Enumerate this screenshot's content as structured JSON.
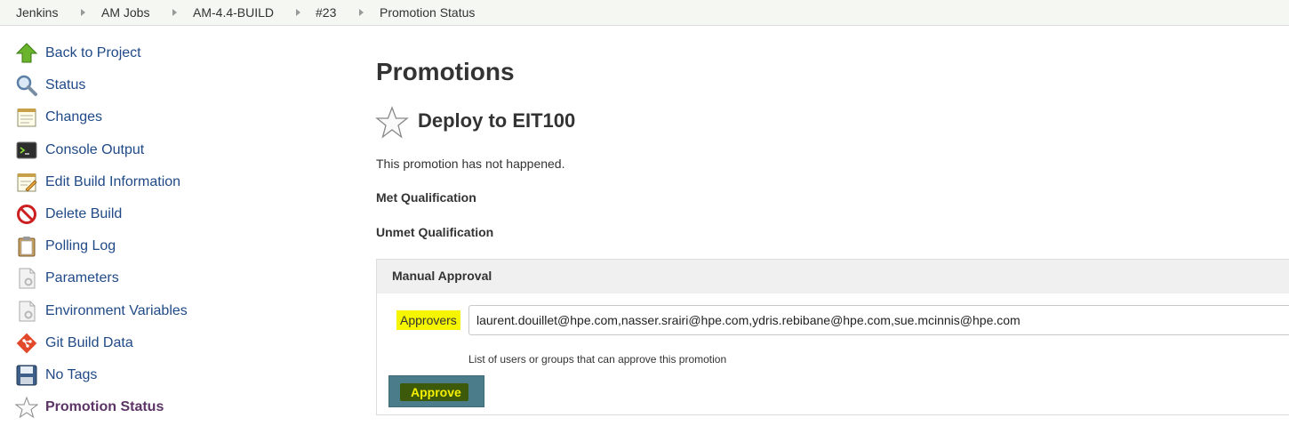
{
  "breadcrumbs": [
    "Jenkins",
    "AM Jobs",
    "AM-4.4-BUILD",
    "#23",
    "Promotion Status"
  ],
  "sidebar": {
    "items": [
      {
        "label": "Back to Project",
        "icon": "up-arrow-icon"
      },
      {
        "label": "Status",
        "icon": "magnifier-icon"
      },
      {
        "label": "Changes",
        "icon": "notepad-icon"
      },
      {
        "label": "Console Output",
        "icon": "terminal-icon"
      },
      {
        "label": "Edit Build Information",
        "icon": "notepad-edit-icon"
      },
      {
        "label": "Delete Build",
        "icon": "no-entry-icon"
      },
      {
        "label": "Polling Log",
        "icon": "clipboard-icon"
      },
      {
        "label": "Parameters",
        "icon": "document-gear-icon"
      },
      {
        "label": "Environment Variables",
        "icon": "document-gear-icon"
      },
      {
        "label": "Git Build Data",
        "icon": "git-icon"
      },
      {
        "label": "No Tags",
        "icon": "floppy-disk-icon"
      },
      {
        "label": "Promotion Status",
        "icon": "star-icon"
      }
    ]
  },
  "main": {
    "title": "Promotions",
    "promotion": {
      "name": "Deploy to EIT100",
      "status": "This promotion has not happened.",
      "met_label": "Met Qualification",
      "unmet_label": "Unmet Qualification",
      "approval": {
        "title": "Manual Approval",
        "approvers_label": "Approvers",
        "approvers_value": "laurent.douillet@hpe.com,nasser.srairi@hpe.com,ydris.rebibane@hpe.com,sue.mcinnis@hpe.com",
        "help_text": "List of users or groups that can approve this promotion",
        "approve_label": "Approve"
      }
    }
  },
  "colors": {
    "link": "#204a87",
    "active_link": "#5c3566",
    "highlight": "#f5f500",
    "approve_button": "#4a7c89",
    "approve_label_bg": "#3d5a0a",
    "approve_label_text": "#f6f000"
  }
}
